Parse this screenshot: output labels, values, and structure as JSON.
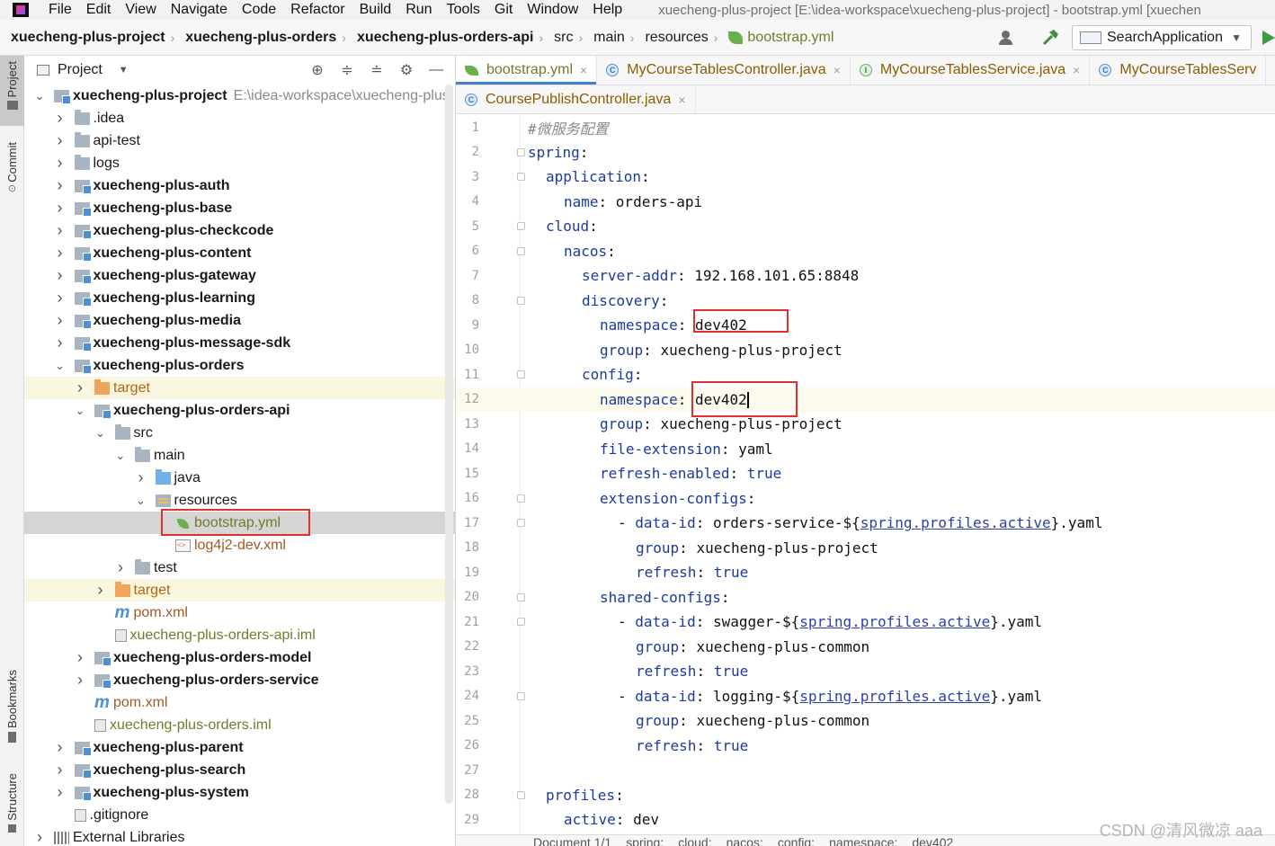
{
  "menubar": {
    "items": [
      "File",
      "Edit",
      "View",
      "Navigate",
      "Code",
      "Refactor",
      "Build",
      "Run",
      "Tools",
      "Git",
      "Window",
      "Help"
    ],
    "mnemonics": [
      "F",
      "E",
      "V",
      "N",
      "C",
      "R",
      "B",
      "u",
      "T",
      "G",
      "W",
      "H"
    ],
    "window_title": "xuecheng-plus-project [E:\\idea-workspace\\xuecheng-plus-project] - bootstrap.yml [xuechen"
  },
  "breadcrumb": {
    "items": [
      "xuecheng-plus-project",
      "xuecheng-plus-orders",
      "xuecheng-plus-orders-api",
      "src",
      "main",
      "resources",
      "bootstrap.yml"
    ]
  },
  "toolbar": {
    "run_config": "SearchApplication"
  },
  "left_strip": {
    "project": "Project",
    "commit": "Commit",
    "bookmarks": "Bookmarks",
    "structure": "Structure"
  },
  "project_panel": {
    "title": "Project",
    "root_path": "E:\\idea-workspace\\xuecheng-plus",
    "tree": [
      {
        "label": "xuecheng-plus-project",
        "depth": 0,
        "toggle": "v",
        "icon": "module",
        "style": "bold"
      },
      {
        "label": ".idea",
        "depth": 1,
        "toggle": ">",
        "icon": "folder",
        "style": ""
      },
      {
        "label": "api-test",
        "depth": 1,
        "toggle": ">",
        "icon": "folder",
        "style": ""
      },
      {
        "label": "logs",
        "depth": 1,
        "toggle": ">",
        "icon": "folder",
        "style": ""
      },
      {
        "label": "xuecheng-plus-auth",
        "depth": 1,
        "toggle": ">",
        "icon": "module",
        "style": "bold"
      },
      {
        "label": "xuecheng-plus-base",
        "depth": 1,
        "toggle": ">",
        "icon": "module",
        "style": "bold"
      },
      {
        "label": "xuecheng-plus-checkcode",
        "depth": 1,
        "toggle": ">",
        "icon": "module",
        "style": "bold"
      },
      {
        "label": "xuecheng-plus-content",
        "depth": 1,
        "toggle": ">",
        "icon": "module",
        "style": "bold"
      },
      {
        "label": "xuecheng-plus-gateway",
        "depth": 1,
        "toggle": ">",
        "icon": "module",
        "style": "bold"
      },
      {
        "label": "xuecheng-plus-learning",
        "depth": 1,
        "toggle": ">",
        "icon": "module",
        "style": "bold"
      },
      {
        "label": "xuecheng-plus-media",
        "depth": 1,
        "toggle": ">",
        "icon": "module",
        "style": "bold"
      },
      {
        "label": "xuecheng-plus-message-sdk",
        "depth": 1,
        "toggle": ">",
        "icon": "module",
        "style": "bold"
      },
      {
        "label": "xuecheng-plus-orders",
        "depth": 1,
        "toggle": "v",
        "icon": "module",
        "style": "bold"
      },
      {
        "label": "target",
        "depth": 2,
        "toggle": ">",
        "icon": "orange",
        "style": "orange",
        "row": "hl-yellow"
      },
      {
        "label": "xuecheng-plus-orders-api",
        "depth": 2,
        "toggle": "v",
        "icon": "module",
        "style": "bold"
      },
      {
        "label": "src",
        "depth": 3,
        "toggle": "v",
        "icon": "folder",
        "style": ""
      },
      {
        "label": "main",
        "depth": 4,
        "toggle": "v",
        "icon": "folder",
        "style": ""
      },
      {
        "label": "java",
        "depth": 5,
        "toggle": ">",
        "icon": "bluefolder",
        "style": ""
      },
      {
        "label": "resources",
        "depth": 5,
        "toggle": "v",
        "icon": "resfolder",
        "style": ""
      },
      {
        "label": "bootstrap.yml",
        "depth": 6,
        "toggle": "",
        "icon": "leaf",
        "style": "olive",
        "row": "selected"
      },
      {
        "label": "log4j2-dev.xml",
        "depth": 6,
        "toggle": "",
        "icon": "xmlfile",
        "style": "brown"
      },
      {
        "label": "test",
        "depth": 4,
        "toggle": ">",
        "icon": "folder",
        "style": ""
      },
      {
        "label": "target",
        "depth": 3,
        "toggle": ">",
        "icon": "orange",
        "style": "orange",
        "row": "hl-yellow"
      },
      {
        "label": "pom.xml",
        "depth": 3,
        "toggle": "",
        "icon": "mfile",
        "style": "brown"
      },
      {
        "label": "xuecheng-plus-orders-api.iml",
        "depth": 3,
        "toggle": "",
        "icon": "imlfile",
        "style": "olive"
      },
      {
        "label": "xuecheng-plus-orders-model",
        "depth": 2,
        "toggle": ">",
        "icon": "module",
        "style": "bold"
      },
      {
        "label": "xuecheng-plus-orders-service",
        "depth": 2,
        "toggle": ">",
        "icon": "module",
        "style": "bold"
      },
      {
        "label": "pom.xml",
        "depth": 2,
        "toggle": "",
        "icon": "mfile",
        "style": "brown"
      },
      {
        "label": "xuecheng-plus-orders.iml",
        "depth": 2,
        "toggle": "",
        "icon": "imlfile",
        "style": "olive"
      },
      {
        "label": "xuecheng-plus-parent",
        "depth": 1,
        "toggle": ">",
        "icon": "module",
        "style": "bold"
      },
      {
        "label": "xuecheng-plus-search",
        "depth": 1,
        "toggle": ">",
        "icon": "module",
        "style": "bold"
      },
      {
        "label": "xuecheng-plus-system",
        "depth": 1,
        "toggle": ">",
        "icon": "module",
        "style": "bold"
      },
      {
        "label": ".gitignore",
        "depth": 1,
        "toggle": "",
        "icon": "gitfile",
        "style": ""
      },
      {
        "label": "External Libraries",
        "depth": 0,
        "toggle": ">",
        "icon": "libs",
        "style": ""
      }
    ]
  },
  "editor": {
    "tabs_row1": [
      {
        "label": "bootstrap.yml",
        "icon": "leaf",
        "active": true
      },
      {
        "label": "MyCourseTablesController.java",
        "icon": "c",
        "active": false
      },
      {
        "label": "MyCourseTablesService.java",
        "icon": "i",
        "active": false
      },
      {
        "label": "MyCourseTablesServ",
        "icon": "c",
        "active": false
      }
    ],
    "tabs_row2": [
      {
        "label": "CoursePublishController.java",
        "icon": "c",
        "active": false
      }
    ],
    "lines": [
      {
        "n": "1",
        "indent": 0,
        "comment": "#微服务配置"
      },
      {
        "n": "2",
        "indent": 0,
        "key": "spring",
        "sep": ":"
      },
      {
        "n": "3",
        "indent": 1,
        "key": "application",
        "sep": ":"
      },
      {
        "n": "4",
        "indent": 2,
        "key": "name",
        "sep": ": ",
        "value": "orders-api"
      },
      {
        "n": "5",
        "indent": 1,
        "key": "cloud",
        "sep": ":"
      },
      {
        "n": "6",
        "indent": 2,
        "key": "nacos",
        "sep": ":"
      },
      {
        "n": "7",
        "indent": 3,
        "key": "server-addr",
        "sep": ": ",
        "value": "192.168.101.65:8848"
      },
      {
        "n": "8",
        "indent": 3,
        "key": "discovery",
        "sep": ":"
      },
      {
        "n": "9",
        "indent": 4,
        "key": "namespace",
        "sep": ": ",
        "value": "dev402"
      },
      {
        "n": "10",
        "indent": 4,
        "key": "group",
        "sep": ": ",
        "value": "xuecheng-plus-project"
      },
      {
        "n": "11",
        "indent": 3,
        "key": "config",
        "sep": ":"
      },
      {
        "n": "12",
        "indent": 4,
        "key": "namespace",
        "sep": ": ",
        "value": "dev402",
        "current": true
      },
      {
        "n": "13",
        "indent": 4,
        "key": "group",
        "sep": ": ",
        "value": "xuecheng-plus-project"
      },
      {
        "n": "14",
        "indent": 4,
        "key": "file-extension",
        "sep": ": ",
        "value": "yaml"
      },
      {
        "n": "15",
        "indent": 4,
        "key": "refresh-enabled",
        "sep": ": ",
        "value": "true",
        "bool": true
      },
      {
        "n": "16",
        "indent": 4,
        "key": "extension-configs",
        "sep": ":"
      },
      {
        "n": "17",
        "indent": 5,
        "dash": true,
        "key": "data-id",
        "sep": ": ",
        "pre": "orders-service-${",
        "link": "spring.profiles.active",
        "post": "}.yaml"
      },
      {
        "n": "18",
        "indent": 6,
        "key": "group",
        "sep": ": ",
        "value": "xuecheng-plus-project"
      },
      {
        "n": "19",
        "indent": 6,
        "key": "refresh",
        "sep": ": ",
        "value": "true",
        "bool": true
      },
      {
        "n": "20",
        "indent": 4,
        "key": "shared-configs",
        "sep": ":"
      },
      {
        "n": "21",
        "indent": 5,
        "dash": true,
        "key": "data-id",
        "sep": ": ",
        "pre": "swagger-${",
        "link": "spring.profiles.active",
        "post": "}.yaml"
      },
      {
        "n": "22",
        "indent": 6,
        "key": "group",
        "sep": ": ",
        "value": "xuecheng-plus-common"
      },
      {
        "n": "23",
        "indent": 6,
        "key": "refresh",
        "sep": ": ",
        "value": "true",
        "bool": true
      },
      {
        "n": "24",
        "indent": 5,
        "dash": true,
        "key": "data-id",
        "sep": ": ",
        "pre": "logging-${",
        "link": "spring.profiles.active",
        "post": "}.yaml"
      },
      {
        "n": "25",
        "indent": 6,
        "key": "group",
        "sep": ": ",
        "value": "xuecheng-plus-common"
      },
      {
        "n": "26",
        "indent": 6,
        "key": "refresh",
        "sep": ": ",
        "value": "true",
        "bool": true
      },
      {
        "n": "27",
        "indent": 0
      },
      {
        "n": "28",
        "indent": 1,
        "key": "profiles",
        "sep": ":"
      },
      {
        "n": "29",
        "indent": 2,
        "key": "active",
        "sep": ": ",
        "value": "dev"
      }
    ]
  },
  "statusbar": {
    "items": [
      "Document 1/1",
      "spring:",
      "cloud:",
      "nacos:",
      "config:",
      "namespace:",
      "dev402"
    ]
  },
  "watermark": "CSDN @清风微凉 aaa",
  "colors": {
    "highlight_box": "#e0312f",
    "yaml_key": "#1d3a9e",
    "active_tab_underline": "#4083c9"
  }
}
